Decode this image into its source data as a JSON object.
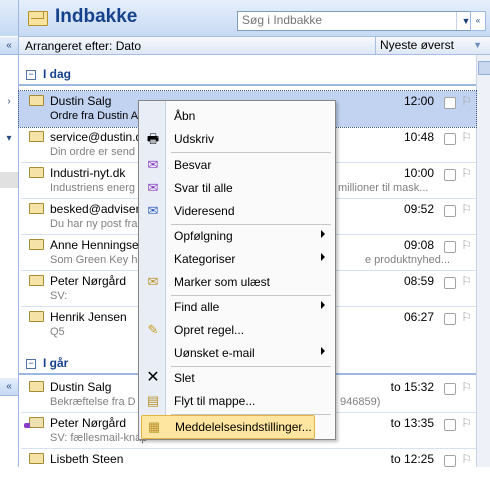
{
  "header": {
    "title": "Indbakke",
    "search_placeholder": "Søg i Indbakke"
  },
  "arrange": {
    "label": "Arrangeret efter: Dato",
    "sort": "Nyeste øverst"
  },
  "groups": {
    "today": "I dag",
    "yesterday": "I går"
  },
  "messages": [
    {
      "sender": "Dustin Salg",
      "time": "12:00",
      "preview": "Ordre fra Dustin A",
      "selected": true
    },
    {
      "sender": "service@dustin.d",
      "time": "10:48",
      "preview": "Din ordre er send"
    },
    {
      "sender": "Industri-nyt.dk",
      "time": "10:00",
      "preview": "Industriens energ",
      "preview_tail": "millioner til mask..."
    },
    {
      "sender": "besked@adviserin",
      "time": "09:52",
      "preview": "Du har ny post fra"
    },
    {
      "sender": "Anne Henningsen",
      "time": "09:08",
      "preview": "Som Green Key ho",
      "preview_tail": "e produktnyhed..."
    },
    {
      "sender": "Peter Nørgård",
      "time": "08:59",
      "preview": "SV:"
    },
    {
      "sender": "Henrik Jensen",
      "time": "06:27",
      "preview": "Q5"
    },
    {
      "sender": "Dustin Salg",
      "time": "to 15:32",
      "preview": "Bekræftelse fra D",
      "preview_tail": "946859)"
    },
    {
      "sender": "Peter Nørgård",
      "time": "to 13:35",
      "preview": "SV: fællesmail-knap"
    },
    {
      "sender": "Lisbeth Steen",
      "time": "to 12:25",
      "preview": ""
    }
  ],
  "context_menu": [
    {
      "label": "Åbn",
      "icon": ""
    },
    {
      "label": "Udskriv",
      "icon": "printer-icon"
    },
    {
      "label": "Besvar",
      "icon": "reply-icon"
    },
    {
      "label": "Svar til alle",
      "icon": "reply-all-icon"
    },
    {
      "label": "Videresend",
      "icon": "forward-icon"
    },
    {
      "label": "Opfølgning",
      "icon": "",
      "submenu": true
    },
    {
      "label": "Kategoriser",
      "icon": "",
      "submenu": true
    },
    {
      "label": "Marker som ulæst",
      "icon": "mark-unread-icon"
    },
    {
      "label": "Find alle",
      "icon": "",
      "submenu": true
    },
    {
      "label": "Opret regel...",
      "icon": "rule-icon"
    },
    {
      "label": "Uønsket e-mail",
      "icon": "",
      "submenu": true
    },
    {
      "label": "Slet",
      "icon": "delete-icon"
    },
    {
      "label": "Flyt til mappe...",
      "icon": "move-folder-icon"
    },
    {
      "label": "Meddelelsesindstillinger...",
      "icon": "message-options-icon"
    }
  ]
}
